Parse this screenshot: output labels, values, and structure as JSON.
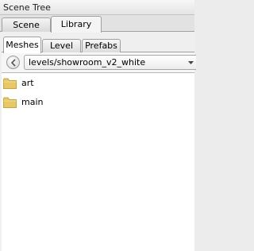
{
  "window": {
    "title": "Scene Tree"
  },
  "main_tabs": [
    {
      "label": "Scene",
      "active": false
    },
    {
      "label": "Library",
      "active": true
    }
  ],
  "sub_tabs": [
    {
      "label": "Meshes",
      "active": true
    },
    {
      "label": "Level",
      "active": false
    },
    {
      "label": "Prefabs",
      "active": false
    }
  ],
  "path": {
    "value": "levels/showroom_v2_white"
  },
  "icons": {
    "back": "chevron-left-icon",
    "dropdown": "chevron-down-icon",
    "folder": "folder-icon"
  },
  "folders": [
    {
      "label": "art"
    },
    {
      "label": "main"
    }
  ],
  "colors": {
    "folder": "#e8c766",
    "folder_dark": "#c9a43a"
  }
}
